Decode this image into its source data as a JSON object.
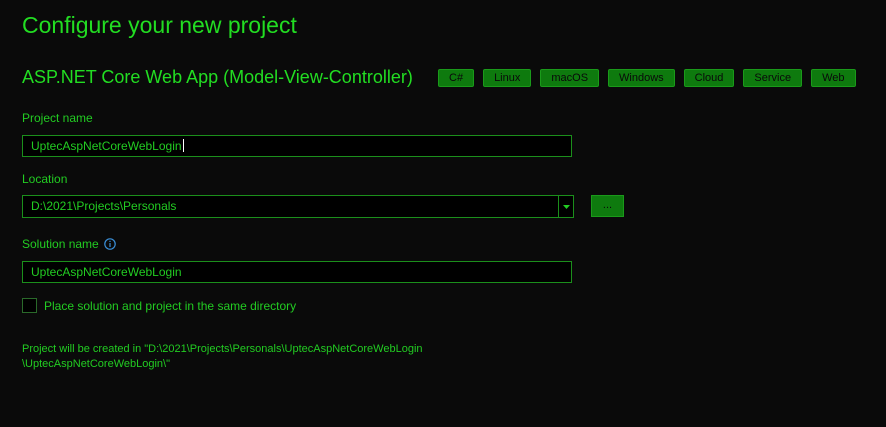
{
  "page": {
    "title": "Configure your new project"
  },
  "template": {
    "name": "ASP.NET Core Web App (Model-View-Controller)",
    "tags": [
      "C#",
      "Linux",
      "macOS",
      "Windows",
      "Cloud",
      "Service",
      "Web"
    ]
  },
  "project_name": {
    "label": "Project name",
    "value": "UptecAspNetCoreWebLogin"
  },
  "location": {
    "label": "Location",
    "value": "D:\\2021\\Projects\\Personals",
    "browse_label": "..."
  },
  "solution_name": {
    "label": "Solution name",
    "value": "UptecAspNetCoreWebLogin",
    "info_icon": "info-icon"
  },
  "same_directory": {
    "label": "Place solution and project in the same directory",
    "checked": false
  },
  "created_note": {
    "line1": "Project will be created in \"D:\\2021\\Projects\\Personals\\UptecAspNetCoreWebLogin",
    "line2": "\\UptecAspNetCoreWebLogin\\\""
  },
  "colors": {
    "background": "#0a0a0a",
    "accent": "#22cc22",
    "tag_background": "#0e7a0e",
    "input_border": "#1b8f1b"
  }
}
